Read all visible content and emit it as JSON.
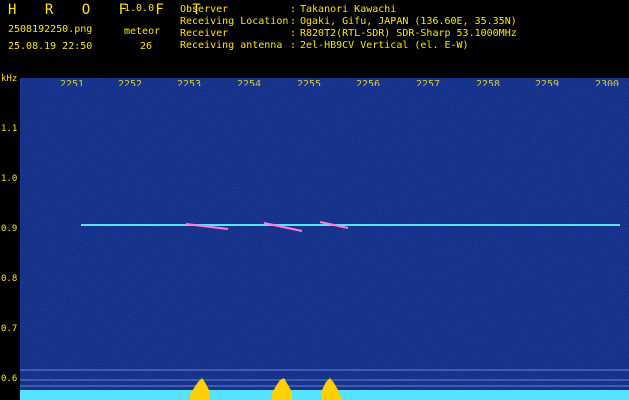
{
  "header": {
    "title": "H R O F F T",
    "version": "1.0.0",
    "filename": "2508192250.png",
    "datetime": "25.08.19 22:50",
    "meteor_label": "meteor",
    "meteor_count": "26"
  },
  "metadata": {
    "observer_label": "Observer",
    "observer_value": "Takanori Kawachi",
    "location_label": "Receiving Location",
    "location_value": "Ogaki, Gifu, JAPAN (136.60E, 35.35N)",
    "receiver_label": "Receiver",
    "receiver_value": "R820T2(RTL-SDR) SDR-Sharp 53.1000MHz",
    "antenna_label": "Receiving antenna",
    "antenna_value": "2el-HB9CV Vertical (el. E-W)"
  },
  "axes": {
    "y_label": "kHz",
    "y_ticks": [
      "1.1",
      "1.0",
      "0.9",
      "0.8",
      "0.7",
      "0.6"
    ],
    "x_ticks": [
      "2251",
      "2252",
      "2253",
      "2254",
      "2255",
      "2256",
      "2257",
      "2258",
      "2259",
      "2300"
    ]
  },
  "colors": {
    "accent": "#ffe500",
    "background": "#0a1a6a",
    "trace": "#57e3ff",
    "spike": "#ffd000"
  }
}
